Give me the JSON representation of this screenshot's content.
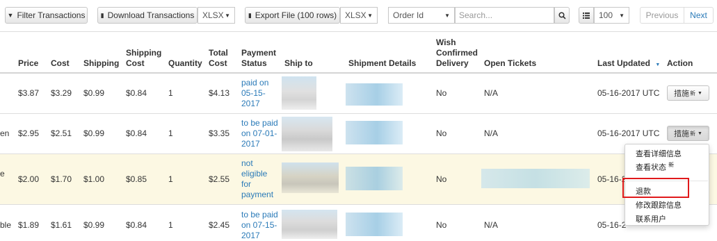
{
  "toolbar": {
    "filter_label": "Filter Transactions",
    "download_label": "Download Transactions",
    "download_format": "XLSX",
    "export_label": "Export File (100 rows)",
    "export_format": "XLSX",
    "search_field": "Order Id",
    "search_placeholder": "Search...",
    "page_size": "100",
    "prev_label": "Previous",
    "next_label": "Next"
  },
  "columns": {
    "price": "Price",
    "cost": "Cost",
    "shipping": "Shipping",
    "shipping_cost_1": "Shipping",
    "shipping_cost_2": "Cost",
    "quantity": "Quantity",
    "total_cost_1": "Total",
    "total_cost_2": "Cost",
    "payment_status_1": "Payment",
    "payment_status_2": "Status",
    "ship_to": "Ship to",
    "shipment_details": "Shipment Details",
    "wish_1": "Wish",
    "wish_2": "Confirmed",
    "wish_3": "Delivery",
    "open_tickets": "Open Tickets",
    "last_updated": "Last Updated",
    "action": "Action"
  },
  "rows": [
    {
      "clip": "",
      "price": "$3.87",
      "cost": "$3.29",
      "shipping": "$0.99",
      "shipping_cost": "$0.84",
      "quantity": "1",
      "total": "$4.13",
      "payment": [
        "paid on",
        "05-15-",
        "2017"
      ],
      "wish": "No",
      "tickets": "N/A",
      "updated": "05-16-2017 UTC"
    },
    {
      "clip": "en",
      "price": "$2.95",
      "cost": "$2.51",
      "shipping": "$0.99",
      "shipping_cost": "$0.84",
      "quantity": "1",
      "total": "$3.35",
      "payment": [
        "to be paid",
        "on 07-01-",
        "2017"
      ],
      "wish": "No",
      "tickets": "N/A",
      "updated": "05-16-2017 UTC"
    },
    {
      "clip": "e",
      "price": "$2.00",
      "cost": "$1.70",
      "shipping": "$1.00",
      "shipping_cost": "$0.85",
      "quantity": "1",
      "total": "$2.55",
      "payment": [
        "not",
        "eligible",
        "for",
        "payment"
      ],
      "wish": "No",
      "tickets": "",
      "updated": "05-16-2"
    },
    {
      "clip": "ble",
      "price": "$1.89",
      "cost": "$1.61",
      "shipping": "$0.99",
      "shipping_cost": "$0.84",
      "quantity": "1",
      "total": "$2.45",
      "payment": [
        "to be paid",
        "on 07-15-",
        "2017"
      ],
      "wish": "No",
      "tickets": "N/A",
      "updated": "05-16-2"
    }
  ],
  "action_button": {
    "label": "措施",
    "badge": "新"
  },
  "action_menu": {
    "view_details": "查看详细信息",
    "view_status": "查看状态",
    "view_status_badge": "新",
    "refund": "退款",
    "modify_tracking": "修改跟踪信息",
    "contact_user": "联系用户"
  },
  "colors": {
    "link": "#2a7ab8",
    "highlight_row": "#fcf8e3",
    "refund_outline": "#e0191b"
  }
}
